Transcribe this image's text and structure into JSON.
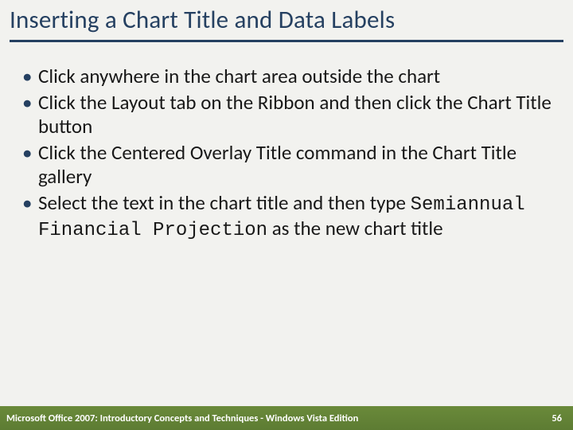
{
  "title": "Inserting a Chart Title and Data Labels",
  "bullets": [
    {
      "text": "Click anywhere in the chart area outside the chart"
    },
    {
      "text": "Click the Layout tab on the Ribbon and then click the Chart Title button"
    },
    {
      "text": "Click the Centered Overlay Title command in the Chart Title gallery"
    },
    {
      "prefix": "Select the text in the chart title and then type ",
      "mono": "Semiannual Financial Projection",
      "suffix": " as the new chart title"
    }
  ],
  "footer": {
    "text": "Microsoft Office 2007: Introductory Concepts and Techniques - Windows Vista Edition",
    "page": "56"
  }
}
